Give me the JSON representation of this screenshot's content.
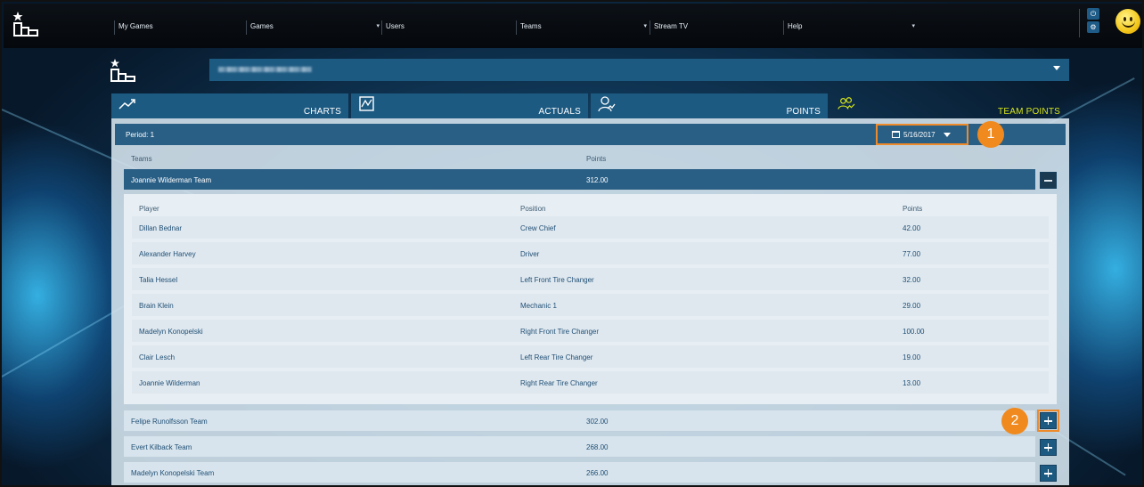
{
  "nav": {
    "items": [
      {
        "label": "My Games",
        "has_caret": false
      },
      {
        "label": "Games",
        "has_caret": true
      },
      {
        "label": "Users",
        "has_caret": false
      },
      {
        "label": "Teams",
        "has_caret": true
      },
      {
        "label": "Stream TV",
        "has_caret": false
      },
      {
        "label": "Help",
        "has_caret": true
      }
    ],
    "power_icon": "⏻",
    "settings_icon": "⚙"
  },
  "team_selector": {
    "value": "(redacted team name)"
  },
  "tabs": {
    "charts": "CHARTS",
    "actuals": "ACTUALS",
    "points": "POINTS",
    "team_points": "TEAM POINTS",
    "active": "team_points"
  },
  "period": {
    "label": "Period: 1",
    "date": "5/16/2017"
  },
  "callouts": {
    "one": "1",
    "two": "2"
  },
  "team_table": {
    "headers": {
      "teams": "Teams",
      "points": "Points"
    },
    "teams": [
      {
        "name": "Joannie Wilderman Team",
        "points": "312.00",
        "expanded": true
      },
      {
        "name": "Felipe Runolfsson Team",
        "points": "302.00",
        "expanded": false
      },
      {
        "name": "Evert Kilback Team",
        "points": "268.00",
        "expanded": false
      },
      {
        "name": "Madelyn Konopelski Team",
        "points": "266.00",
        "expanded": false
      }
    ]
  },
  "player_table": {
    "headers": {
      "player": "Player",
      "position": "Position",
      "points": "Points"
    },
    "rows": [
      {
        "player": "Dillan Bednar",
        "position": "Crew Chief",
        "points": "42.00"
      },
      {
        "player": "Alexander Harvey",
        "position": "Driver",
        "points": "77.00"
      },
      {
        "player": "Talia Hessel",
        "position": "Left Front Tire Changer",
        "points": "32.00"
      },
      {
        "player": "Brain Klein",
        "position": "Mechanic 1",
        "points": "29.00"
      },
      {
        "player": "Madelyn Konopelski",
        "position": "Right Front Tire Changer",
        "points": "100.00"
      },
      {
        "player": "Clair Lesch",
        "position": "Left Rear Tire Changer",
        "points": "19.00"
      },
      {
        "player": "Joannie Wilderman",
        "position": "Right Rear Tire Changer",
        "points": "13.00"
      }
    ]
  },
  "colors": {
    "accent_blue": "#1d5a82",
    "active_tab": "#d6e41a",
    "callout_orange": "#f08a1e",
    "panel_bg": "#d3e2ec"
  }
}
